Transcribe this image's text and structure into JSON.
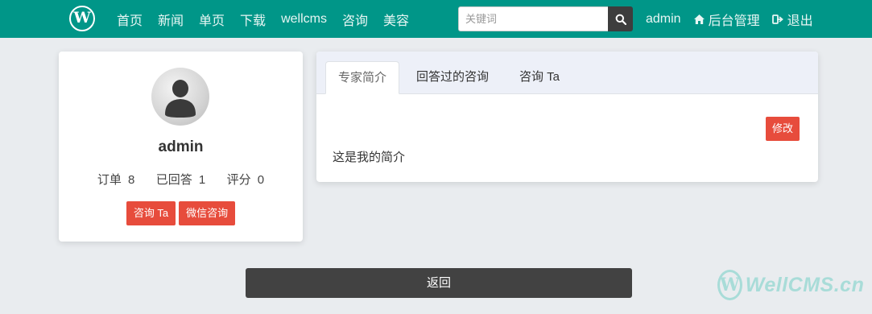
{
  "navbar": {
    "logo_letter": "W",
    "links": [
      "首页",
      "新闻",
      "单页",
      "下载",
      "wellcms",
      "咨询",
      "美容"
    ],
    "search_placeholder": "关键词",
    "user": "admin",
    "admin_link": "后台管理",
    "logout_link": "退出",
    "brand_color": "#009688"
  },
  "profile": {
    "username": "admin",
    "orders_label": "订单",
    "orders": "8",
    "answered_label": "已回答",
    "answered": "1",
    "rating_label": "评分",
    "rating": "0",
    "consult_button": "咨询 Ta",
    "wechat_button": "微信咨询"
  },
  "tabs": {
    "items": [
      "专家简介",
      "回答过的咨询",
      "咨询 Ta"
    ],
    "active_index": 0,
    "edit_button": "修改",
    "intro_text": "这是我的简介"
  },
  "back_button": "返回",
  "watermark": {
    "letter": "W",
    "text": "WellCMS.cn"
  }
}
